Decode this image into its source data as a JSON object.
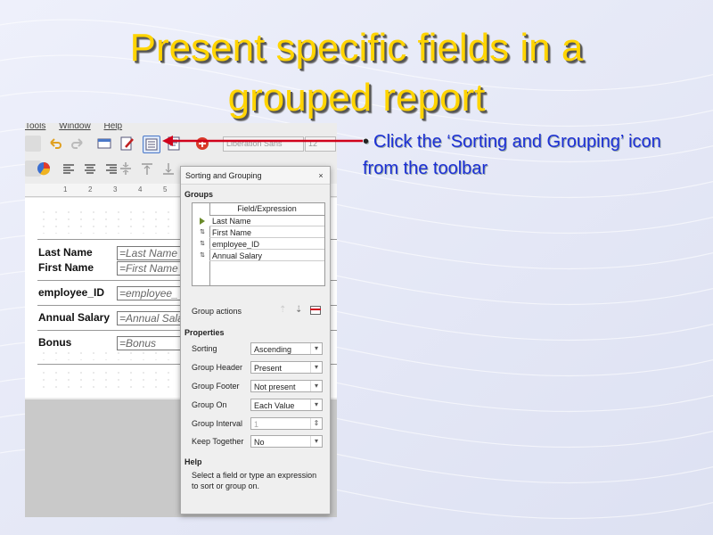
{
  "slide": {
    "title_line1": "Present specific fields in a",
    "title_line2": "grouped report",
    "bullet": "Click the ‘Sorting and Grouping’ icon from the toolbar",
    "colors": {
      "title": "#ffd400",
      "bullet": "#1c2fd6",
      "arrow": "#d0021b"
    }
  },
  "app": {
    "menu": [
      "Tools",
      "Window",
      "Help"
    ],
    "toolbar_combo_font": "Liberation Sans",
    "toolbar_combo_size": "12",
    "ruler_ticks": [
      "1",
      "2",
      "3",
      "4",
      "5"
    ],
    "fields": [
      {
        "label": "Last Name",
        "value": "=Last Name"
      },
      {
        "label": "First Name",
        "value": "=First Name"
      },
      {
        "label": "employee_ID",
        "value": "=employee_"
      },
      {
        "label": "Annual Salary",
        "value": "=Annual Sala"
      },
      {
        "label": "Bonus",
        "value": "=Bonus"
      }
    ]
  },
  "dialog": {
    "title": "Sorting and Grouping",
    "close": "×",
    "groups_heading": "Groups",
    "column_header": "Field/Expression",
    "rows": [
      {
        "icon": "triangle-right-icon",
        "text": "Last Name"
      },
      {
        "icon": "sort-icon",
        "text": "First Name"
      },
      {
        "icon": "sort-icon",
        "text": "employee_ID"
      },
      {
        "icon": "sort-icon",
        "text": "Annual Salary"
      }
    ],
    "group_actions_label": "Group actions",
    "properties_heading": "Properties",
    "properties": [
      {
        "label": "Sorting",
        "value": "Ascending",
        "kind": "select"
      },
      {
        "label": "Group Header",
        "value": "Present",
        "kind": "select"
      },
      {
        "label": "Group Footer",
        "value": "Not present",
        "kind": "select"
      },
      {
        "label": "Group On",
        "value": "Each Value",
        "kind": "select"
      },
      {
        "label": "Group Interval",
        "value": "1",
        "kind": "spin"
      },
      {
        "label": "Keep Together",
        "value": "No",
        "kind": "select"
      }
    ],
    "help_heading": "Help",
    "help_text": "Select a field or type an expression to sort or group on."
  }
}
